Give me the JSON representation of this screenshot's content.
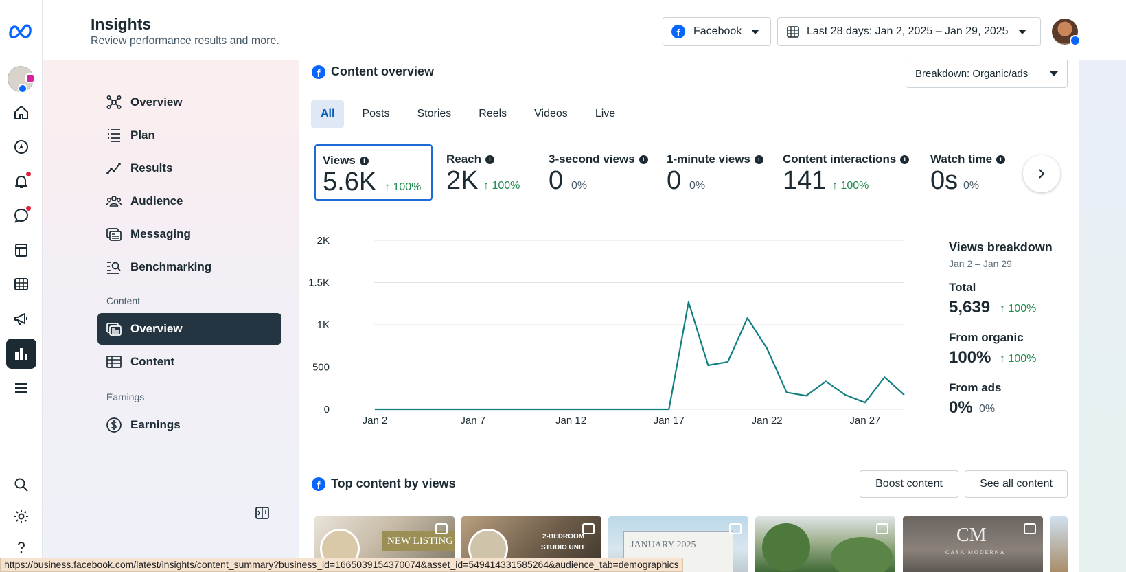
{
  "header": {
    "title": "Insights",
    "subtitle": "Review performance results and more.",
    "platform_dropdown": "Facebook",
    "date_dropdown": "Last 28 days: Jan 2, 2025 – Jan 29, 2025"
  },
  "nav": {
    "items": [
      {
        "label": "Overview",
        "icon": "overview-icon"
      },
      {
        "label": "Plan",
        "icon": "plan-icon"
      },
      {
        "label": "Results",
        "icon": "results-icon"
      },
      {
        "label": "Audience",
        "icon": "audience-icon"
      },
      {
        "label": "Messaging",
        "icon": "messaging-icon"
      },
      {
        "label": "Benchmarking",
        "icon": "benchmarking-icon"
      }
    ],
    "content_section": "Content",
    "content_items": [
      {
        "label": "Overview",
        "active": true
      },
      {
        "label": "Content",
        "active": false
      }
    ],
    "earnings_section": "Earnings",
    "earnings_items": [
      {
        "label": "Earnings"
      }
    ]
  },
  "content_overview": {
    "title": "Content overview",
    "breakdown": "Breakdown: Organic/ads",
    "tabs": [
      "All",
      "Posts",
      "Stories",
      "Reels",
      "Videos",
      "Live"
    ],
    "active_tab": "All",
    "metrics": [
      {
        "label": "Views",
        "value": "5.6K",
        "change": "100%",
        "up": true,
        "selected": true
      },
      {
        "label": "Reach",
        "value": "2K",
        "change": "100%",
        "up": true
      },
      {
        "label": "3-second views",
        "value": "0",
        "change": "0%",
        "up": false
      },
      {
        "label": "1-minute views",
        "value": "0",
        "change": "0%",
        "up": false
      },
      {
        "label": "Content interactions",
        "value": "141",
        "change": "100%",
        "up": true
      },
      {
        "label": "Watch time",
        "value": "0s",
        "change": "0%",
        "up": false
      }
    ]
  },
  "chart_data": {
    "type": "line",
    "x": [
      "Jan 2",
      "Jan 3",
      "Jan 4",
      "Jan 5",
      "Jan 6",
      "Jan 7",
      "Jan 8",
      "Jan 9",
      "Jan 10",
      "Jan 11",
      "Jan 12",
      "Jan 13",
      "Jan 14",
      "Jan 15",
      "Jan 16",
      "Jan 17",
      "Jan 18",
      "Jan 19",
      "Jan 20",
      "Jan 21",
      "Jan 22",
      "Jan 23",
      "Jan 24",
      "Jan 25",
      "Jan 26",
      "Jan 27",
      "Jan 28",
      "Jan 29"
    ],
    "series": [
      {
        "name": "Views",
        "color": "#127f80",
        "values": [
          0,
          0,
          0,
          0,
          0,
          0,
          0,
          0,
          0,
          0,
          0,
          0,
          0,
          0,
          0,
          0,
          1270,
          520,
          560,
          1080,
          720,
          200,
          160,
          330,
          170,
          80,
          380,
          170
        ]
      }
    ],
    "x_tick_labels": [
      "Jan 2",
      "Jan 7",
      "Jan 12",
      "Jan 17",
      "Jan 22",
      "Jan 27"
    ],
    "y_ticks": [
      0,
      500,
      1000,
      1500,
      2000
    ],
    "y_tick_labels": [
      "0",
      "500",
      "1K",
      "1.5K",
      "2K"
    ],
    "ylim": [
      0,
      2000
    ],
    "grid": true,
    "legend": "bottom-center"
  },
  "views_breakdown": {
    "title": "Views breakdown",
    "range": "Jan 2 – Jan 29",
    "total_label": "Total",
    "total_value": "5,639",
    "total_change": "100%",
    "organic_label": "From organic",
    "organic_value": "100%",
    "organic_change": "100%",
    "ads_label": "From ads",
    "ads_value": "0%",
    "ads_change": "0%"
  },
  "top_content": {
    "title": "Top content by views",
    "boost_label": "Boost content",
    "see_all_label": "See all content",
    "thumb_captions": [
      "NEW LISTING",
      "2-BEDROOM",
      "STUDIO UNIT",
      "JANUARY 2025",
      "CASA MODERNA"
    ]
  },
  "statusbar": {
    "url": "https://business.facebook.com/latest/insights/content_summary?business_id=1665039154370074&asset_id=549414331585264&audience_tab=demographics"
  },
  "colors": {
    "accent": "#0866ff",
    "line": "#127f80",
    "positive": "#1f8a4c",
    "nav_active": "#253441"
  }
}
